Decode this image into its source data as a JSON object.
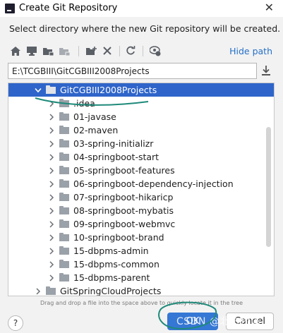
{
  "window": {
    "title": "Create Git Repository",
    "close_icon": "close-icon"
  },
  "prompt": "Select directory where the new Git repository will be created.",
  "toolbar": {
    "icons": [
      "home-icon",
      "desktop-icon",
      "project-folder-icon",
      "module-folder-icon",
      "new-folder-icon",
      "delete-icon",
      "refresh-icon",
      "show-hidden-icon"
    ],
    "hide_path": "Hide path"
  },
  "path": {
    "value": "E:\\TCGBIII\\GitCGBIII2008Projects"
  },
  "tree": {
    "root": "GitCGBIII2008Projects",
    "children": [
      ".idea",
      "01-javase",
      "02-maven",
      "03-spring-initializr",
      "04-springboot-start",
      "05-springboot-features",
      "06-springboot-dependency-injection",
      "07-springboot-hikaricp",
      "08-springboot-mybatis",
      "09-springboot-webmvc",
      "10-springboot-brand",
      "15-dbpms-admin",
      "15-dbpms-common",
      "15-dbpms-parent"
    ],
    "sibling": "GitSpringCloudProjects"
  },
  "hint": "Drag and drop a file into the space above to quickly locate it in the tree",
  "buttons": {
    "help": "?",
    "ok": "OK",
    "cancel": "Cancel"
  },
  "watermark": "CSDN @北古桥溪",
  "colors": {
    "selection": "#2f65ca",
    "link": "#2470c8",
    "ok_button": "#3577d4",
    "annotation": "#1f8a7a"
  }
}
